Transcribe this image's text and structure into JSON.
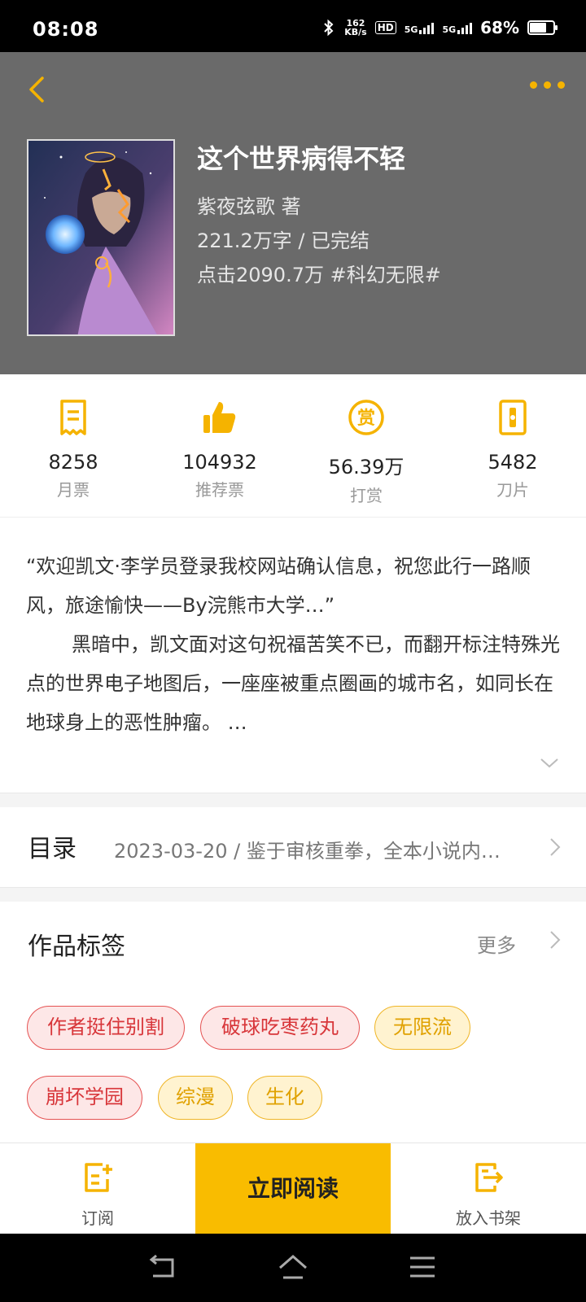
{
  "status_bar": {
    "time": "08:08",
    "net_speed_top": "162",
    "net_speed_bottom": "KB/s",
    "hd": "HD",
    "sig1": "5G",
    "sig2": "5G",
    "battery": "68%",
    "battery_level": 0.68
  },
  "book": {
    "title": "这个世界病得不轻",
    "author_line": "紫夜弦歌  著",
    "words_status": "221.2万字 / 已完结",
    "clicks_genre": "点击2090.7万  #科幻无限#"
  },
  "stats": [
    {
      "icon": "monthly-ticket-icon",
      "value": "8258",
      "label": "月票"
    },
    {
      "icon": "thumbs-up-icon",
      "value": "104932",
      "label": "推荐票"
    },
    {
      "icon": "reward-icon",
      "value": "56.39万",
      "label": "打赏"
    },
    {
      "icon": "blade-icon",
      "value": "5482",
      "label": "刀片"
    }
  ],
  "intro": {
    "p1": "“欢迎凯文·李学员登录我校网站确认信息，祝您此行一路顺风，旅途愉快——By浣熊市大学…”",
    "p2": "黑暗中，凯文面对这句祝福苦笑不已，而翻开标注特殊光点的世界电子地图后，一座座被重点圈画的城市名，如同长在地球身上的恶性肿瘤。 …"
  },
  "catalog": {
    "title": "目录",
    "latest": "2023-03-20 / 鉴于审核重拳，全本小说内…"
  },
  "tags": {
    "title": "作品标签",
    "more": "更多",
    "items": [
      {
        "label": "作者挺住别割",
        "style": "red"
      },
      {
        "label": "破球吃枣药丸",
        "style": "red"
      },
      {
        "label": "无限流",
        "style": "yellow"
      },
      {
        "label": "崩坏学园",
        "style": "red"
      },
      {
        "label": "综漫",
        "style": "yellow"
      },
      {
        "label": "生化",
        "style": "yellow"
      }
    ]
  },
  "actions": {
    "subscribe": "订阅",
    "read_now": "立即阅读",
    "add_shelf": "放入书架"
  },
  "colors": {
    "accent": "#f9bc00",
    "tag_red": "#d8363a",
    "tag_yellow": "#e0a100",
    "header_bg": "#6a6a6a"
  }
}
